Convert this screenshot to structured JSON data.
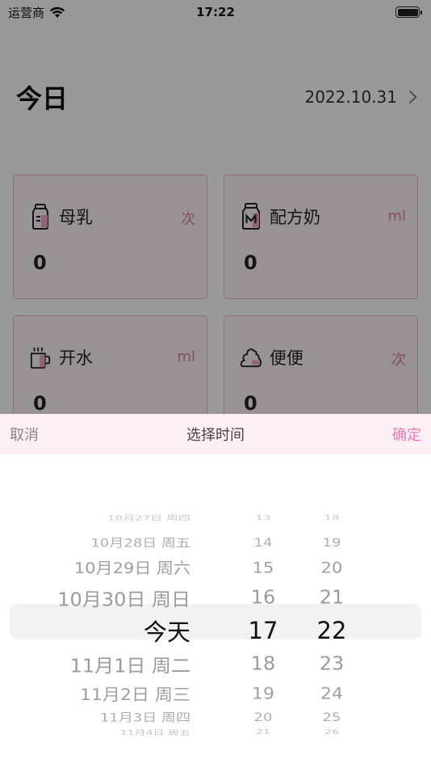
{
  "status_bar": {
    "carrier": "运营商",
    "time": "17:22"
  },
  "header": {
    "title": "今日",
    "date": "2022.10.31"
  },
  "cards": [
    {
      "name": "母乳",
      "unit": "次",
      "value": "0",
      "icon": "bottle-icon"
    },
    {
      "name": "配方奶",
      "unit": "ml",
      "value": "0",
      "icon": "formula-jar-icon"
    },
    {
      "name": "开水",
      "unit": "ml",
      "value": "0",
      "icon": "cup-icon"
    },
    {
      "name": "便便",
      "unit": "次",
      "value": "0",
      "icon": "poop-icon"
    }
  ],
  "sheet": {
    "cancel_label": "取消",
    "title": "选择时间",
    "confirm_label": "确定"
  },
  "picker": {
    "rows": [
      {
        "date": "10月27日 周四",
        "hour": "13",
        "minute": "18"
      },
      {
        "date": "10月28日 周五",
        "hour": "14",
        "minute": "19"
      },
      {
        "date": "10月29日 周六",
        "hour": "15",
        "minute": "20"
      },
      {
        "date": "10月30日 周日",
        "hour": "16",
        "minute": "21"
      },
      {
        "date": "今天",
        "hour": "17",
        "minute": "22"
      },
      {
        "date": "11月1日 周二",
        "hour": "18",
        "minute": "23"
      },
      {
        "date": "11月2日 周三",
        "hour": "19",
        "minute": "24"
      },
      {
        "date": "11月3日 周四",
        "hour": "20",
        "minute": "25"
      },
      {
        "date": "11月4日 周五",
        "hour": "21",
        "minute": "26"
      }
    ],
    "selected_index": 4
  },
  "colors": {
    "accent": "#e87ab5",
    "card_border": "#f3b6d0",
    "toolbar_bg": "#fdf0f5"
  }
}
